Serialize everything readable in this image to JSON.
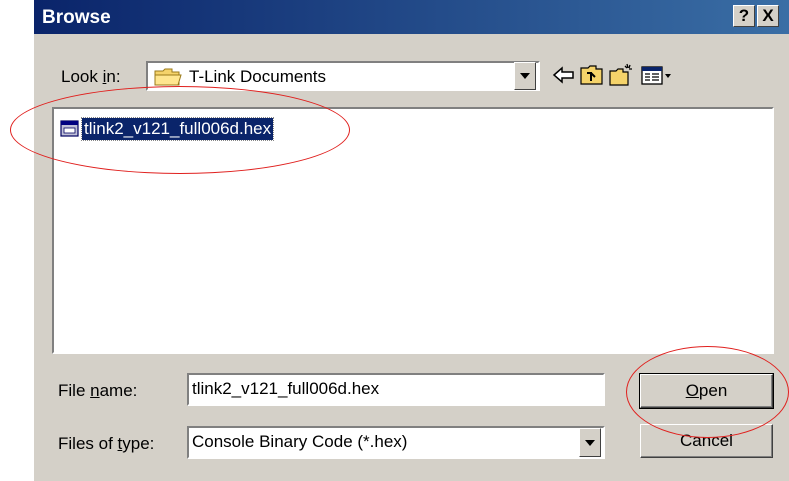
{
  "dialog": {
    "title": "Browse",
    "help_button": "?",
    "close_button": "X"
  },
  "look_in": {
    "label_pre": "Look ",
    "label_u": "i",
    "label_post": "n:",
    "value": "T-Link Documents"
  },
  "toolbar": {
    "back_icon": "back-arrow-icon",
    "up_icon": "up-one-level-icon",
    "new_folder_icon": "new-folder-icon",
    "view_icon": "view-menu-icon"
  },
  "files": [
    {
      "name": "tlink2_v121_full006d.hex",
      "icon": "hex-file-icon",
      "selected": true
    }
  ],
  "file_name": {
    "label_pre": "File ",
    "label_u": "n",
    "label_post": "ame:",
    "value": "tlink2_v121_full006d.hex"
  },
  "file_type": {
    "label_pre": "Files of ",
    "label_u": "t",
    "label_post": "ype:",
    "value": "Console Binary Code (*.hex)"
  },
  "buttons": {
    "open_u": "O",
    "open_rest": "pen",
    "cancel": "Cancel"
  },
  "annotation_color": "#e0201e",
  "selection_color": "#0a246a"
}
